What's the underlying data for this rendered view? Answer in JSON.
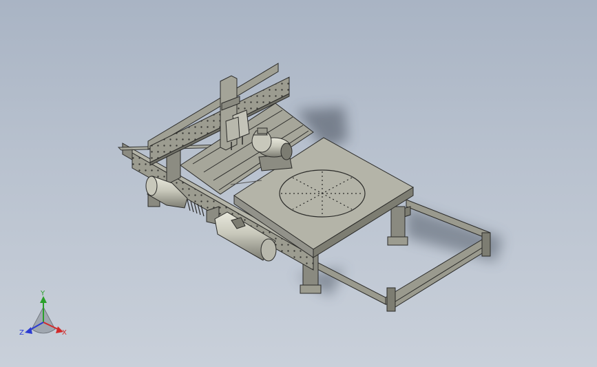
{
  "viewport": {
    "background_top": "#a9b4c4",
    "background_bottom": "#c9d0da"
  },
  "model": {
    "frame_color": "#9e9e92",
    "frame_dark": "#6f6f66",
    "top_color": "#b4b4a8",
    "edge_color": "#2a2a28",
    "features": [
      "gantry",
      "spindle-heads",
      "motor",
      "rotary-table",
      "cylinders",
      "slide-frame"
    ]
  },
  "triad": {
    "x_label": "X",
    "y_label": "Y",
    "z_label": "Z",
    "x_color": "#d22a2a",
    "y_color": "#2aa02a",
    "z_color": "#2a3ad2"
  }
}
